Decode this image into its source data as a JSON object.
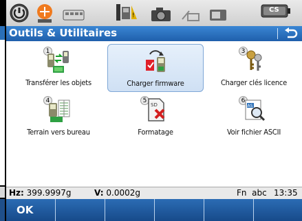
{
  "title": "Outils & Utilitaires",
  "status_icons": [
    "power-icon",
    "satellite-icon",
    "keyboard-icon",
    "station-icon",
    "camera-icon",
    "radio-icon",
    "card-icon",
    "battery-icon"
  ],
  "battery_label": "CS",
  "tiles": [
    {
      "num": "1",
      "label": "Transférer les objets",
      "icon": "transfer-objects-icon"
    },
    {
      "num": "",
      "label": "Charger firmware",
      "icon": "load-firmware-icon"
    },
    {
      "num": "3",
      "label": "Charger clés licence",
      "icon": "license-keys-icon"
    },
    {
      "num": "4",
      "label": "Terrain vers bureau",
      "icon": "field-to-office-icon"
    },
    {
      "num": "5",
      "label": "Formatage",
      "icon": "format-icon"
    },
    {
      "num": "6",
      "label": "Voir fichier ASCII",
      "icon": "ascii-file-icon"
    }
  ],
  "infobar": {
    "hz_label": "Hz:",
    "hz_value": "399.9997g",
    "v_label": "V:",
    "v_value": "0.0002g",
    "fn": "Fn  abc",
    "time": "13:35"
  },
  "softkeys": [
    "OK",
    "",
    "",
    "",
    "",
    ""
  ]
}
